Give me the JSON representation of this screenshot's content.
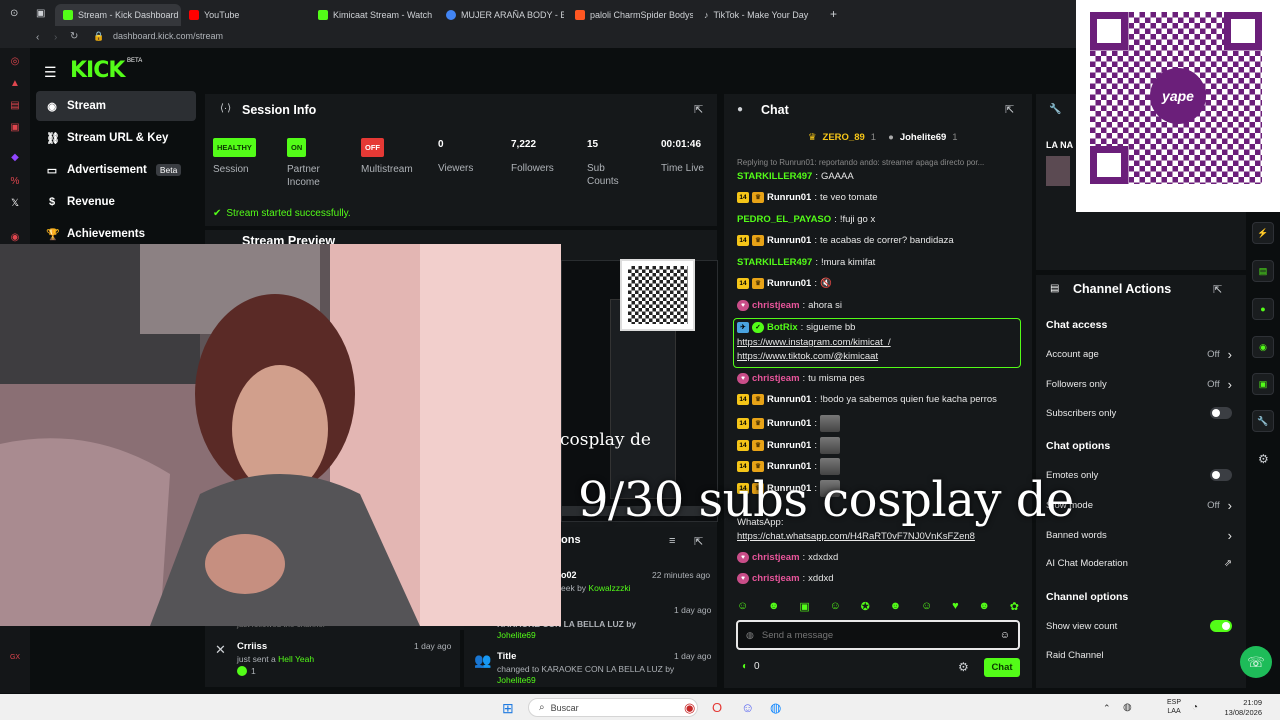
{
  "browser": {
    "tabs": [
      {
        "title": "Stream - Kick Dashboard",
        "color": "#53fc18"
      },
      {
        "title": "YouTube",
        "color": "#ff0000"
      },
      {
        "title": "Kimicaat Stream - Watch L",
        "color": "#53fc18"
      },
      {
        "title": "MUJER ARAÑA BODY - Bu",
        "color": "#4285f4"
      },
      {
        "title": "paloli CharmSpider Bodysu",
        "color": "#ff5722"
      },
      {
        "title": "TikTok - Make Your Day",
        "color": "#111111"
      }
    ],
    "url": "dashboard.kick.com/stream"
  },
  "kick": {
    "logo": "KICK",
    "beta": "BETA"
  },
  "sidebar": {
    "items": [
      {
        "label": "Stream",
        "icon": "broadcast-icon"
      },
      {
        "label": "Stream URL & Key",
        "icon": "link-icon"
      },
      {
        "label": "Advertisement",
        "tag": "Beta",
        "icon": "ad-icon"
      },
      {
        "label": "Revenue",
        "icon": "money-icon"
      },
      {
        "label": "Achievements",
        "icon": "trophy-icon"
      }
    ]
  },
  "session": {
    "title": "Session Info",
    "stats": [
      {
        "value": "HEALTHY",
        "label": "Session",
        "badge_color": "#53fc18"
      },
      {
        "value": "ON",
        "label": "Partner Income",
        "badge_color": "#53fc18"
      },
      {
        "value": "OFF",
        "label": "Multistream",
        "badge_color": "#e53935"
      },
      {
        "value": "0",
        "label": "Viewers"
      },
      {
        "value": "7,222",
        "label": "Followers"
      },
      {
        "value": "15",
        "label": "Sub Counts"
      },
      {
        "value": "00:01:46",
        "label": "Time Live"
      }
    ],
    "status": "Stream started successfully."
  },
  "preview": {
    "title": "Stream Preview"
  },
  "activity": {
    "title_partial": "ons",
    "items": [
      {
        "name": "Crriiss",
        "text": "just sent a",
        "gift": "Hell Yeah",
        "time": "1 day ago",
        "amount": "1"
      },
      {
        "name": "o02",
        "text": "eek by",
        "by": "Kowalzzzki",
        "time": "22 minutes ago"
      },
      {
        "name": "",
        "text": "KARAOKE CON LA BELLA LUZ",
        "by": "Johelite69",
        "time": "1 day ago"
      },
      {
        "name": "Title",
        "text": "changed to KARAOKE CON LA BELLA LUZ by",
        "by": "Johelite69",
        "time": "1 day ago"
      }
    ],
    "followed_text": "just followed the channel"
  },
  "chat": {
    "title": "Chat",
    "pinned_users": [
      {
        "name": "ZERO_89",
        "count": "1"
      },
      {
        "name": "Johelite69",
        "count": "1"
      }
    ],
    "reply_text": "Replying to Runrun01: reportando ando: streamer apaga directo por...",
    "messages": [
      {
        "user": "STARKILLER497",
        "text": "GAAAA",
        "color": "#53fc18",
        "badges": []
      },
      {
        "user": "Runrun01",
        "text": "te veo tomate",
        "color": "#ffffff",
        "badges": [
          "14",
          "crown"
        ]
      },
      {
        "user": "PEDRO_EL_PAYASO",
        "text": "!fuji go x",
        "color": "#53fc18",
        "badges": []
      },
      {
        "user": "Runrun01",
        "text": "te acabas de correr? bandidaza",
        "color": "#ffffff",
        "badges": [
          "14",
          "crown"
        ]
      },
      {
        "user": "STARKILLER497",
        "text": "!mura kimifat",
        "color": "#53fc18",
        "badges": []
      },
      {
        "user": "Runrun01",
        "text": "🔇",
        "color": "#ffffff",
        "badges": [
          "14",
          "crown"
        ]
      },
      {
        "user": "christjeam",
        "text": "ahora si",
        "color": "#e8559b",
        "badges": [
          "pink"
        ]
      }
    ],
    "bot": {
      "user": "BotRix",
      "text": "sigueme bb",
      "links": [
        "https://www.instagram.com/kimicat_/",
        "https://www.tiktok.com/@kimicaat"
      ]
    },
    "messages2": [
      {
        "user": "christjeam",
        "text": "tu misma pes",
        "color": "#e8559b",
        "badges": [
          "pink"
        ]
      },
      {
        "user": "Runrun01",
        "text": "!bodo ya sabemos quien fue kacha perros",
        "color": "#ffffff",
        "badges": [
          "14",
          "crown"
        ]
      },
      {
        "user": "Runrun01",
        "text": "",
        "color": "#ffffff",
        "badges": [
          "14",
          "crown"
        ],
        "emote": true
      },
      {
        "user": "Runrun01",
        "text": "",
        "color": "#ffffff",
        "badges": [
          "14",
          "crown"
        ],
        "emote": true
      },
      {
        "user": "Runrun01",
        "text": "",
        "color": "#ffffff",
        "badges": [
          "14",
          "crown"
        ],
        "emote": true
      },
      {
        "user": "Runrun01",
        "text": "",
        "color": "#ffffff",
        "badges": [
          "14",
          "crown"
        ],
        "emote": true
      }
    ],
    "whatsapp": {
      "prefix": "WhatsApp:",
      "link": "https://chat.whatsapp.com/H4RaRT0vF7NJ0VnKsFZen8"
    },
    "messages3": [
      {
        "user": "christjeam",
        "text": "xdxdxd",
        "color": "#e8559b",
        "badges": [
          "pink"
        ]
      },
      {
        "user": "christjeam",
        "text": "xddxd",
        "color": "#e8559b",
        "badges": [
          "pink"
        ]
      }
    ],
    "input_placeholder": "Send a message",
    "points": "0",
    "send_label": "Chat"
  },
  "channel_actions": {
    "title": "Channel Actions",
    "partial_title": "LA NA",
    "chat_access": {
      "title": "Chat access",
      "rows": [
        {
          "label": "Account age",
          "value": "Off",
          "kind": "chevron"
        },
        {
          "label": "Followers only",
          "value": "Off",
          "kind": "chevron"
        },
        {
          "label": "Subscribers only",
          "kind": "toggle",
          "on": false
        }
      ]
    },
    "chat_options": {
      "title": "Chat options",
      "rows": [
        {
          "label": "Emotes only",
          "kind": "toggle",
          "on": false
        },
        {
          "label": "Slow mode",
          "value": "Off",
          "kind": "chevron"
        },
        {
          "label": "Banned words",
          "kind": "chevron"
        },
        {
          "label": "AI Chat Moderation",
          "kind": "external"
        }
      ]
    },
    "channel_options": {
      "title": "Channel options",
      "rows": [
        {
          "label": "Show view count",
          "kind": "toggle",
          "on": true
        },
        {
          "label": "Raid Channel",
          "kind": "none"
        }
      ]
    }
  },
  "overlay": {
    "big_text": "9/30 subs cosplay de",
    "small_text": "cosplay de",
    "qr_brand": "yape"
  },
  "taskbar": {
    "search_placeholder": "Buscar",
    "lang_top": "ESP",
    "lang_bottom": "LAA",
    "time": "21:09",
    "date": "13/08/2026"
  },
  "colors": {
    "accent": "#53fc18",
    "panel": "#15181a",
    "bg": "#0b0e0f"
  }
}
